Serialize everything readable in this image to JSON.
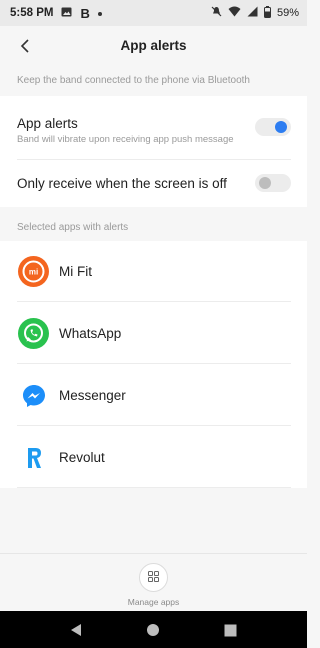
{
  "status_bar": {
    "time": "5:58 PM",
    "battery": "59%",
    "icons": [
      "image-icon",
      "b-icon",
      "dot-icon",
      "mute-icon",
      "wifi-icon",
      "signal-icon",
      "battery-icon"
    ]
  },
  "header": {
    "title": "App alerts",
    "back_icon": "back-arrow-icon"
  },
  "info_text": "Keep the band connected to the phone via Bluetooth",
  "settings": [
    {
      "title": "App alerts",
      "description": "Band will vibrate upon receiving app push message",
      "enabled": true
    },
    {
      "title": "Only receive when the screen is off",
      "enabled": false
    }
  ],
  "apps_section_label": "Selected apps with alerts",
  "apps": [
    {
      "name": "Mi Fit",
      "icon": "mi-fit-icon",
      "color": "#f4651f"
    },
    {
      "name": "WhatsApp",
      "icon": "whatsapp-icon",
      "color": "#29c24e"
    },
    {
      "name": "Messenger",
      "icon": "messenger-icon",
      "color": "#1c8ef9"
    },
    {
      "name": "Revolut",
      "icon": "revolut-icon",
      "color": "#1d9bf0"
    }
  ],
  "footer": {
    "manage_label": "Manage apps",
    "manage_icon": "grid-icon"
  },
  "nav_bar": {
    "buttons": [
      "back-triangle-icon",
      "home-circle-icon",
      "recents-square-icon"
    ]
  },
  "colors": {
    "accent": "#2d7df1",
    "background": "#f6f6f6",
    "card": "#ffffff"
  }
}
